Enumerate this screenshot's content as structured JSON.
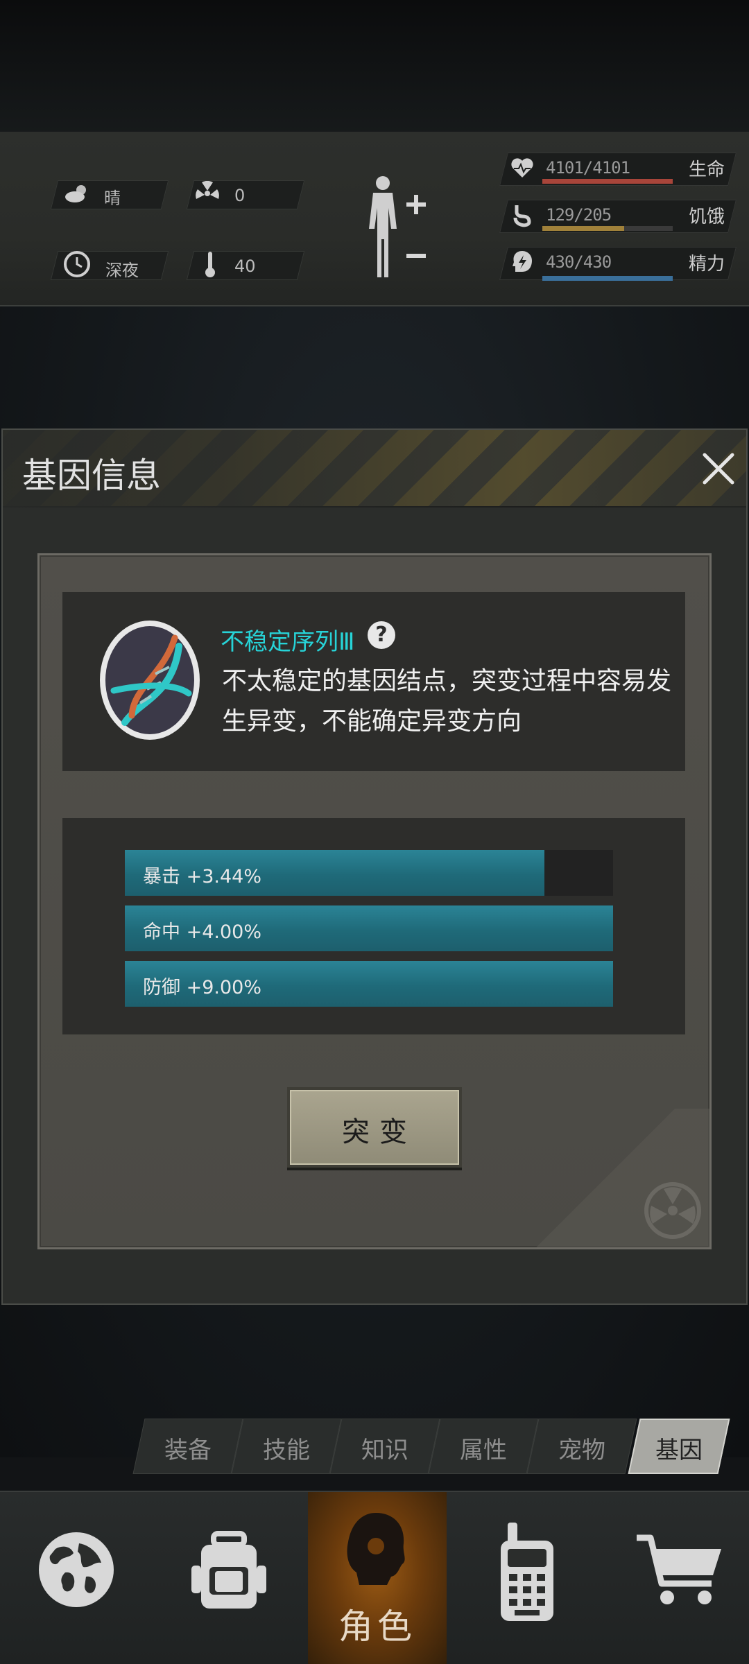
{
  "hud": {
    "weather": {
      "icon": "cloudy-sun-icon",
      "label": "晴"
    },
    "radiation": {
      "icon": "radiation-icon",
      "value": "0"
    },
    "time": {
      "icon": "clock-icon",
      "label": "深夜"
    },
    "temperature": {
      "icon": "thermometer-icon",
      "value": "40"
    },
    "stats": [
      {
        "icon": "heart-icon",
        "value": "4101/4101",
        "name": "生命",
        "fill": 1.0,
        "color": "#a8453a"
      },
      {
        "icon": "stomach-icon",
        "value": "129/205",
        "name": "饥饿",
        "fill": 0.63,
        "color": "#a0813a"
      },
      {
        "icon": "brain-bolt-icon",
        "value": "430/430",
        "name": "精力",
        "fill": 1.0,
        "color": "#3a6f9a"
      }
    ]
  },
  "dialog": {
    "title": "基因信息",
    "gene": {
      "name": "不稳定序列Ⅲ",
      "description": "不太稳定的基因结点，突变过程中容易发生异变，不能确定异变方向"
    },
    "attributes": [
      {
        "label": "暴击 +3.44%",
        "fill": 0.86
      },
      {
        "label": "命中 +4.00%",
        "fill": 1.0
      },
      {
        "label": "防御 +9.00%",
        "fill": 1.0
      }
    ],
    "mutate_label": "突变"
  },
  "tabs": [
    {
      "label": "装备",
      "active": false
    },
    {
      "label": "技能",
      "active": false
    },
    {
      "label": "知识",
      "active": false
    },
    {
      "label": "属性",
      "active": false
    },
    {
      "label": "宠物",
      "active": false
    },
    {
      "label": "基因",
      "active": true
    }
  ],
  "nav": {
    "items": [
      {
        "icon": "globe-icon"
      },
      {
        "icon": "backpack-icon"
      },
      {
        "icon": "character-icon",
        "label": "角色",
        "active": true
      },
      {
        "icon": "radio-icon"
      },
      {
        "icon": "cart-icon"
      }
    ]
  }
}
